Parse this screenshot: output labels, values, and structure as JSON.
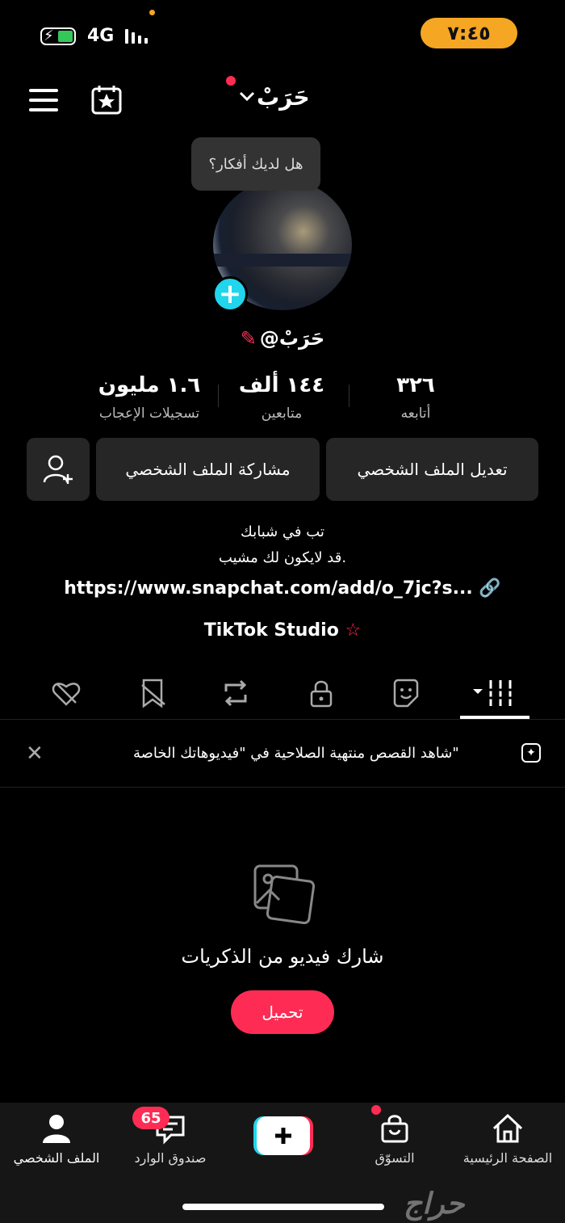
{
  "status_bar": {
    "time": "٧:٤٥",
    "network": "4G"
  },
  "header": {
    "username": "حَرَبْ"
  },
  "profile": {
    "tooltip": "هل لديك أفكار؟",
    "handle": "@حَرَبْ",
    "stats": [
      {
        "value": "١.٦ مليون",
        "label": "تسجيلات الإعجاب"
      },
      {
        "value": "١٤٤ ألف",
        "label": "متابعين"
      },
      {
        "value": "٣٢٦",
        "label": "أتابعه"
      }
    ],
    "edit_button": "تعديل الملف الشخصي",
    "share_button": "مشاركة الملف الشخصي",
    "bio_line1": "تب في شبابك",
    "bio_line2": "قد لايكون لك مشيب.",
    "link": "https://www.snapchat.com/add/o_7jc?s...",
    "studio": "TikTok Studio"
  },
  "banner": {
    "text": "شاهد القصص منتهية الصلاحية في \"فيديوهاتك الخاصة\""
  },
  "empty_state": {
    "title": "شارك فيديو من الذكريات",
    "upload_button": "تحميل"
  },
  "bottom_nav": {
    "home": "الصفحة الرئيسية",
    "shop": "التسوّق",
    "inbox": "صندوق الوارد",
    "inbox_badge": "65",
    "profile": "الملف الشخصي"
  },
  "watermark": "حراج",
  "colors": {
    "accent": "#fe2c55",
    "cyan": "#20d5ec",
    "time_pill": "#f5a623",
    "button_bg": "#262626"
  }
}
